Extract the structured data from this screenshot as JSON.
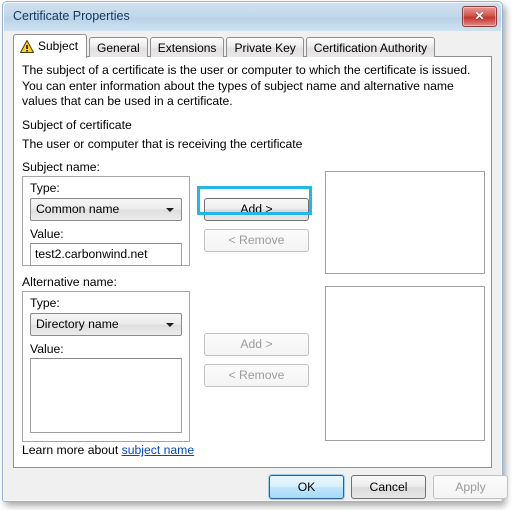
{
  "window": {
    "title": "Certificate Properties",
    "close_glyph": "✕",
    "close_icon_name": "close-icon"
  },
  "tabs": [
    {
      "label": "Subject",
      "selected": true,
      "icon": "warning-triangle-icon"
    },
    {
      "label": "General",
      "selected": false
    },
    {
      "label": "Extensions",
      "selected": false
    },
    {
      "label": "Private Key",
      "selected": false
    },
    {
      "label": "Certification Authority",
      "selected": false
    }
  ],
  "page": {
    "description": "The subject of a certificate is the user or computer to which the certificate is issued. You can enter information about the types of subject name and alternative name values that can be used in a certificate.",
    "section_title": "Subject of certificate",
    "section_subtitle": "The user or computer that is receiving the certificate"
  },
  "subject_name": {
    "group_label": "Subject name:",
    "type_label": "Type:",
    "type_value": "Common name",
    "value_label": "Value:",
    "value_text": "test2.carbonwind.net",
    "add_label": "Add >",
    "remove_label": "< Remove",
    "add_enabled": true,
    "remove_enabled": false,
    "list_items": []
  },
  "alternative_name": {
    "group_label": "Alternative name:",
    "type_label": "Type:",
    "type_value": "Directory name",
    "value_label": "Value:",
    "value_text": "",
    "add_label": "Add >",
    "remove_label": "< Remove",
    "add_enabled": false,
    "remove_enabled": false,
    "list_items": []
  },
  "learn_more": {
    "prefix": "Learn more about ",
    "link_text": "subject name"
  },
  "footer": {
    "ok_label": "OK",
    "cancel_label": "Cancel",
    "apply_label": "Apply",
    "apply_enabled": false
  },
  "colors": {
    "annotation_highlight": "#24b6e8",
    "titlebar": "#c3d8ec",
    "link": "#0645c3",
    "close_button": "#c4352e",
    "warning_yellow": "#ffd21f"
  }
}
